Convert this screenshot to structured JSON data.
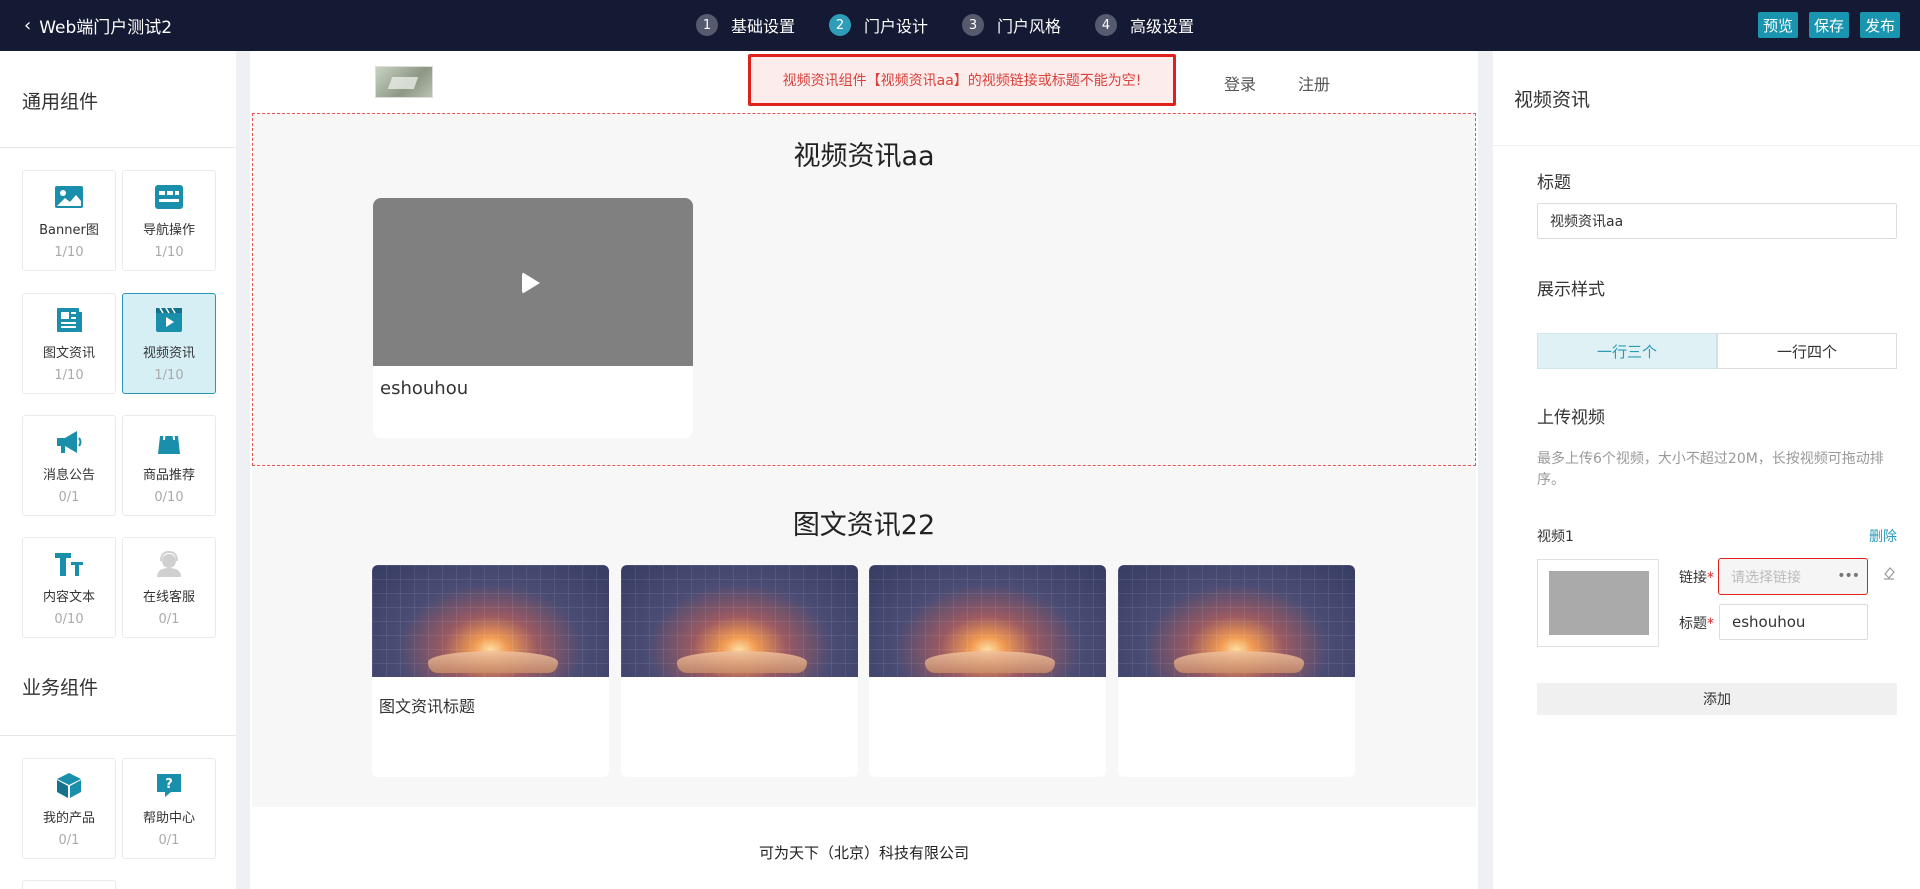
{
  "header": {
    "back_label": "Web端门户测试2",
    "steps": [
      {
        "num": "1",
        "label": "基础设置"
      },
      {
        "num": "2",
        "label": "门户设计"
      },
      {
        "num": "3",
        "label": "门户风格"
      },
      {
        "num": "4",
        "label": "高级设置"
      }
    ],
    "active_step": 2,
    "actions": {
      "preview": "预览",
      "save": "保存",
      "publish": "发布"
    }
  },
  "left": {
    "general_title": "通用组件",
    "business_title": "业务组件",
    "general_items": [
      {
        "label": "Banner图",
        "count": "1/10",
        "icon": "image-icon"
      },
      {
        "label": "导航操作",
        "count": "1/10",
        "icon": "navigation-icon"
      },
      {
        "label": "图文资讯",
        "count": "1/10",
        "icon": "article-icon"
      },
      {
        "label": "视频资讯",
        "count": "1/10",
        "icon": "video-icon"
      },
      {
        "label": "消息公告",
        "count": "0/1",
        "icon": "megaphone-icon"
      },
      {
        "label": "商品推荐",
        "count": "0/10",
        "icon": "shopping-bag-icon"
      },
      {
        "label": "内容文本",
        "count": "0/10",
        "icon": "text-icon"
      },
      {
        "label": "在线客服",
        "count": "0/1",
        "icon": "customer-service-icon"
      }
    ],
    "business_items": [
      {
        "label": "我的产品",
        "count": "0/1",
        "icon": "cube-icon"
      },
      {
        "label": "帮助中心",
        "count": "0/1",
        "icon": "help-icon"
      }
    ]
  },
  "canvas": {
    "error_message": "视频资讯组件【视频资讯aa】的视频链接或标题不能为空!",
    "nav": {
      "login": "登录",
      "register": "注册"
    },
    "video_section": {
      "title": "视频资讯aa",
      "card_caption": "eshouhou"
    },
    "news_section": {
      "title": "图文资讯22",
      "cards": [
        "图文资讯标题",
        "",
        "",
        ""
      ]
    },
    "footer": "可为天下（北京）科技有限公司"
  },
  "right": {
    "panel_title": "视频资讯",
    "title_label": "标题",
    "title_value": "视频资讯aa",
    "display_label": "展示样式",
    "display_options": [
      "一行三个",
      "一行四个"
    ],
    "upload_label": "上传视频",
    "upload_hint": "最多上传6个视频，大小不超过20M，长按视频可拖动排序。",
    "video_item_label": "视频1",
    "delete_label": "删除",
    "link_label": "链接",
    "link_placeholder": "请选择链接",
    "video_title_label": "标题",
    "video_title_value": "eshouhou",
    "add_label": "添加",
    "required_mark": "*"
  },
  "colors": {
    "topbar": "#141a33",
    "accent": "#1995b0",
    "error": "#e0201d"
  }
}
